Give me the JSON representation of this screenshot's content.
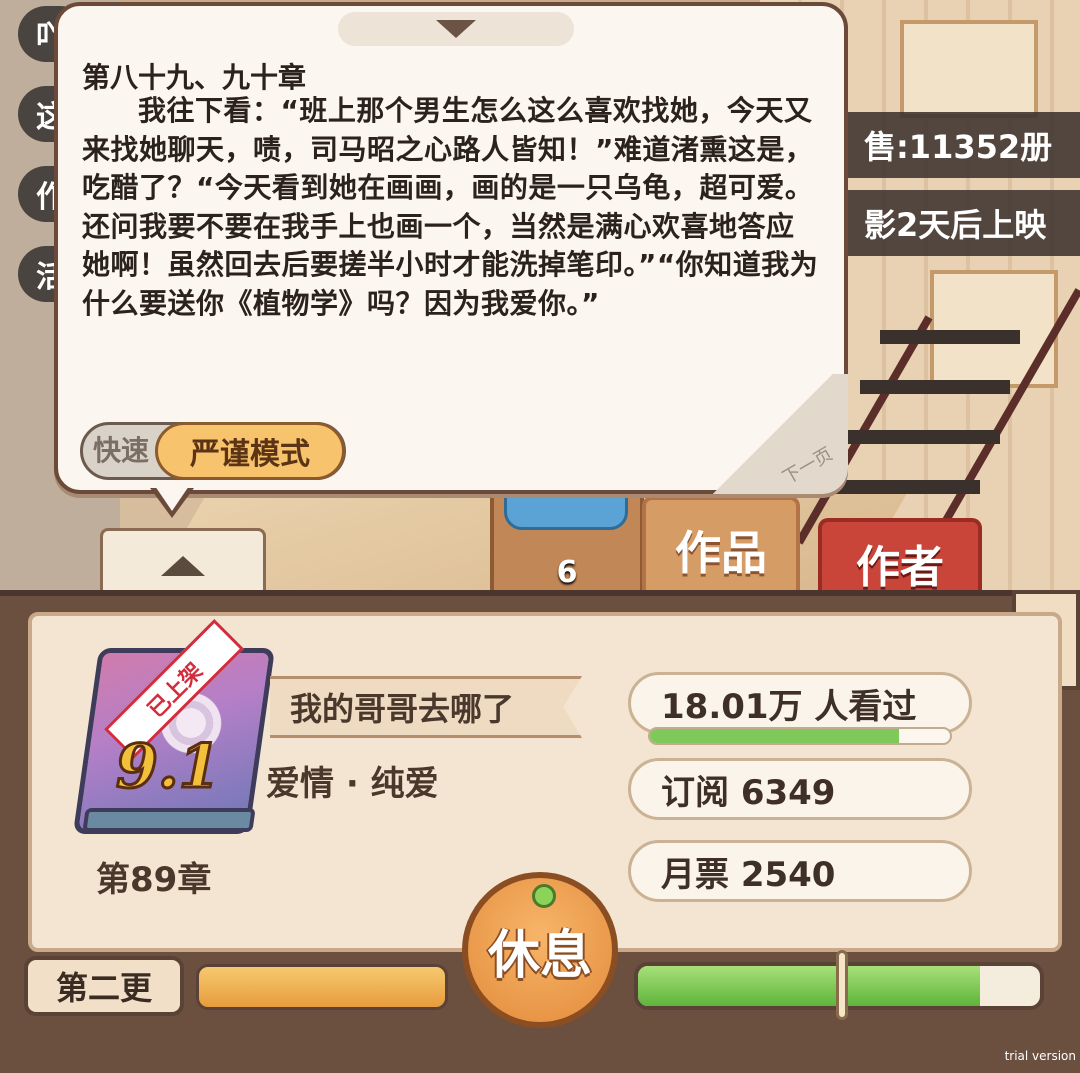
{
  "background": {
    "left_pills": [
      "吖",
      "这",
      "作",
      "活"
    ],
    "sales_text": "售:11352册",
    "movie_text": "影2天后上映",
    "tabs": {
      "works": "作品",
      "author": "作者"
    },
    "notification_count": "6"
  },
  "reading": {
    "chapter_title": "第八十九、九十章",
    "body": "我往下看：“班上那个男生怎么这么喜欢找她，今天又来找她聊天，啧，司马昭之心路人皆知！”难道渚熏这是，吃醋了？“今天看到她在画画，画的是一只乌龟，超可爱。还问我要不要在我手上也画一个，当然是满心欢喜地答应她啊！虽然回去后要搓半小时才能洗掉笔印。”“你知道我为什么要送你《植物学》吗？因为我爱你。”",
    "mode_fast": "快速",
    "mode_strict": "严谨模式",
    "next_page": "下一页"
  },
  "book": {
    "badge": "已上架",
    "score": "9.1",
    "chapter": "第89章",
    "title": "我的哥哥去哪了",
    "genre": "爱情 · 纯爱",
    "views": "18.01万  人看过",
    "views_progress": 0.83,
    "subscriptions": "订阅  6349",
    "monthly_votes": "月票  2540"
  },
  "controls": {
    "update_button": "第二更",
    "left_progress": 1.0,
    "rest_button": "休息",
    "right_progress": 0.85
  },
  "watermark": "trial version",
  "colors": {
    "accent_orange": "#e79c3d",
    "progress_green": "#5fb43b",
    "author_tab_red": "#c9453a",
    "score_gold": "#f2c03a"
  }
}
